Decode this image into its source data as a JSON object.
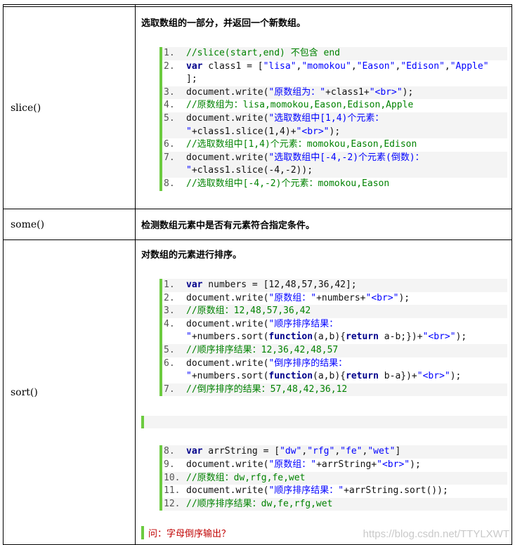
{
  "slice": {
    "name": "slice()",
    "desc": "选取数组的一部分，并返回一个新数组。",
    "lines": [
      {
        "n": "1.",
        "html": "<span class=\"cm\">//slice(start,end) 不包含 end</span>"
      },
      {
        "n": "2.",
        "html": "<span class=\"kw\">var</span> class1 = [<span class=\"str\">\"lisa\"</span>,<span class=\"str\">\"momokou\"</span>,<span class=\"str\">\"Eason\"</span>,<span class=\"str\">\"Edison\"</span>,<span class=\"str\">\"Apple\"</span>\n];"
      },
      {
        "n": "3.",
        "html": "document.write(<span class=\"str\">\"原数组为：\"</span>+class1+<span class=\"str\">\"&lt;br&gt;\"</span>);"
      },
      {
        "n": "4.",
        "html": "<span class=\"cm\">//原数组为：lisa,momokou,Eason,Edison,Apple</span>"
      },
      {
        "n": "5.",
        "html": "document.write(<span class=\"str\">\"选取数组中[1,4)个元素：</span>\n<span class=\"str\">\"</span>+class1.slice(1,4)+<span class=\"str\">\"&lt;br&gt;\"</span>);"
      },
      {
        "n": "6.",
        "html": "<span class=\"cm\">//选取数组中[1,4)个元素：momokou,Eason,Edison</span>"
      },
      {
        "n": "7.",
        "html": "document.write(<span class=\"str\">\"选取数组中[-4,-2)个元素(倒数)：</span>\n<span class=\"str\">\"</span>+class1.slice(-4,-2));"
      },
      {
        "n": "8.",
        "html": "<span class=\"cm\">//选取数组中[-4,-2)个元素：momokou,Eason</span>"
      }
    ]
  },
  "some": {
    "name": "some()",
    "desc": "检测数组元素中是否有元素符合指定条件。"
  },
  "sort": {
    "name": "sort()",
    "desc": "对数组的元素进行排序。",
    "lines_a": [
      {
        "n": "1.",
        "html": "<span class=\"kw\">var</span> numbers = [12,48,57,36,42];"
      },
      {
        "n": "2.",
        "html": "document.write(<span class=\"str\">\"原数组：\"</span>+numbers+<span class=\"str\">\"&lt;br&gt;\"</span>);"
      },
      {
        "n": "3.",
        "html": "<span class=\"cm\">//原数组：12,48,57,36,42</span>"
      },
      {
        "n": "4.",
        "html": "document.write(<span class=\"str\">\"顺序排序结果：</span>\n<span class=\"str\">\"</span>+numbers.sort(<span class=\"kw\">function</span>(a,b){<span class=\"kw\">return</span> a-b;})+<span class=\"str\">\"&lt;br&gt;\"</span>);"
      },
      {
        "n": "5.",
        "html": "<span class=\"cm\">//顺序排序结果：12,36,42,48,57</span>"
      },
      {
        "n": "6.",
        "html": "document.write(<span class=\"str\">\"倒序排序的结果：</span>\n<span class=\"str\">\"</span>+numbers.sort(<span class=\"kw\">function</span>(a,b){<span class=\"kw\">return</span> b-a})+<span class=\"str\">\"&lt;br&gt;\"</span>);"
      },
      {
        "n": "7.",
        "html": "<span class=\"cm\">//倒序排序的结果：57,48,42,36,12</span>"
      }
    ],
    "lines_b": [
      {
        "n": "8.",
        "html": "<span class=\"kw\">var</span> arrString = [<span class=\"str\">\"dw\"</span>,<span class=\"str\">\"rfg\"</span>,<span class=\"str\">\"fe\"</span>,<span class=\"str\">\"wet\"</span>]"
      },
      {
        "n": "9.",
        "html": "document.write(<span class=\"str\">\"原数组：\"</span>+arrString+<span class=\"str\">\"&lt;br&gt;\"</span>);"
      },
      {
        "n": "10.",
        "html": "<span class=\"cm\">//原数组：dw,rfg,fe,wet</span>"
      },
      {
        "n": "11.",
        "html": "document.write(<span class=\"str\">\"顺序排序结果：\"</span>+arrString.sort());"
      },
      {
        "n": "12.",
        "html": "<span class=\"cm\">//顺序排序结果：dw,fe,rfg,wet</span>"
      }
    ],
    "question": "问：字母倒序输出？"
  },
  "watermark": "https://blog.csdn.net/TTYLXWT"
}
